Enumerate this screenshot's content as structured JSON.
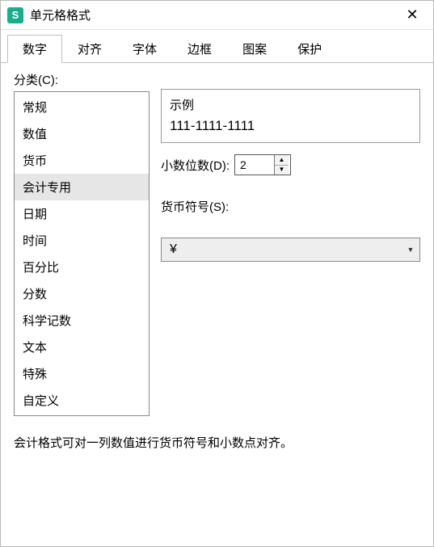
{
  "window": {
    "title": "单元格格式",
    "icon_text": "S"
  },
  "tabs": [
    "数字",
    "对齐",
    "字体",
    "边框",
    "图案",
    "保护"
  ],
  "active_tab": 0,
  "category": {
    "label": "分类(C):",
    "items": [
      "常规",
      "数值",
      "货币",
      "会计专用",
      "日期",
      "时间",
      "百分比",
      "分数",
      "科学记数",
      "文本",
      "特殊",
      "自定义"
    ],
    "selected_index": 3
  },
  "example": {
    "label": "示例",
    "value": "111-1111-1111"
  },
  "decimal": {
    "label": "小数位数(D):",
    "value": "2"
  },
  "currency": {
    "label": "货币符号(S):",
    "value": "¥"
  },
  "description": "会计格式可对一列数值进行货币符号和小数点对齐。"
}
